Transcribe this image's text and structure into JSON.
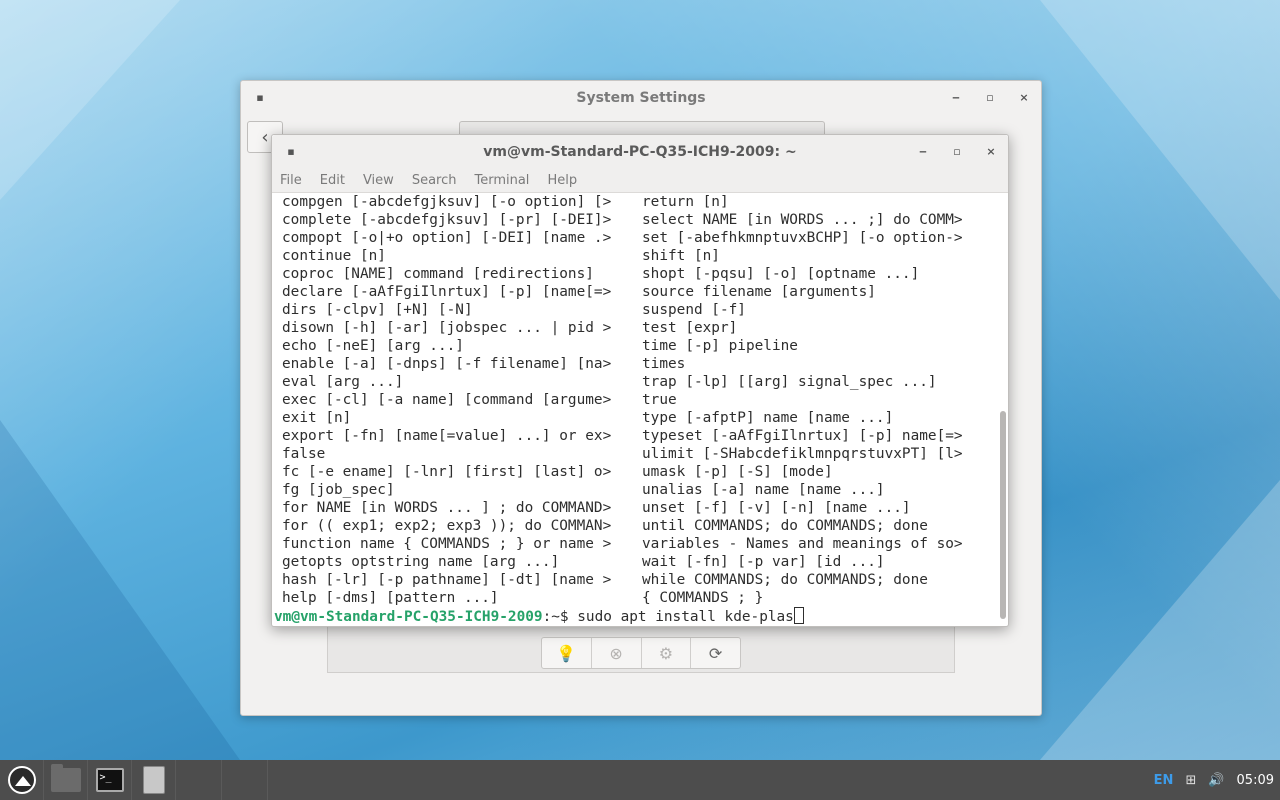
{
  "settings_window": {
    "title": "System Settings",
    "minimize": "‒",
    "maximize": "▫",
    "close": "×",
    "back": "‹",
    "toolbar": [
      "💡",
      "⊗",
      "⚙",
      "⟳"
    ]
  },
  "terminal_window": {
    "title": "vm@vm-Standard-PC-Q35-ICH9-2009: ~",
    "minimize": "‒",
    "maximize": "▫",
    "close": "×",
    "menu": [
      "File",
      "Edit",
      "View",
      "Search",
      "Terminal",
      "Help"
    ],
    "left_column": [
      "compgen [-abcdefgjksuv] [-o option] [>",
      "complete [-abcdefgjksuv] [-pr] [-DEI]>",
      "compopt [-o|+o option] [-DEI] [name .>",
      "continue [n]",
      "coproc [NAME] command [redirections]",
      "declare [-aAfFgiIlnrtux] [-p] [name[=>",
      "dirs [-clpv] [+N] [-N]",
      "disown [-h] [-ar] [jobspec ... | pid >",
      "echo [-neE] [arg ...]",
      "enable [-a] [-dnps] [-f filename] [na>",
      "eval [arg ...]",
      "exec [-cl] [-a name] [command [argume>",
      "exit [n]",
      "export [-fn] [name[=value] ...] or ex>",
      "false",
      "fc [-e ename] [-lnr] [first] [last] o>",
      "fg [job_spec]",
      "for NAME [in WORDS ... ] ; do COMMAND>",
      "for (( exp1; exp2; exp3 )); do COMMAN>",
      "function name { COMMANDS ; } or name >",
      "getopts optstring name [arg ...]",
      "hash [-lr] [-p pathname] [-dt] [name >",
      "help [-dms] [pattern ...]"
    ],
    "right_column": [
      "return [n]",
      "select NAME [in WORDS ... ;] do COMM>",
      "set [-abefhkmnptuvxBCHP] [-o option->",
      "shift [n]",
      "shopt [-pqsu] [-o] [optname ...]",
      "source filename [arguments]",
      "suspend [-f]",
      "test [expr]",
      "time [-p] pipeline",
      "times",
      "trap [-lp] [[arg] signal_spec ...]",
      "true",
      "type [-afptP] name [name ...]",
      "typeset [-aAfFgiIlnrtux] [-p] name[=>",
      "ulimit [-SHabcdefiklmnpqrstuvxPT] [l>",
      "umask [-p] [-S] [mode]",
      "unalias [-a] name [name ...]",
      "unset [-f] [-v] [-n] [name ...]",
      "until COMMANDS; do COMMANDS; done",
      "variables - Names and meanings of so>",
      "wait [-fn] [-p var] [id ...]",
      "while COMMANDS; do COMMANDS; done",
      "{ COMMANDS ; }"
    ],
    "prompt_user": "vm@vm-Standard-PC-Q35-ICH9-2009",
    "prompt_path": ":~$ ",
    "command": "sudo apt install kde-plas"
  },
  "taskbar": {
    "language": "EN",
    "network_icon": "network-icon",
    "volume_icon": "volume-icon",
    "clock": "05:09"
  }
}
